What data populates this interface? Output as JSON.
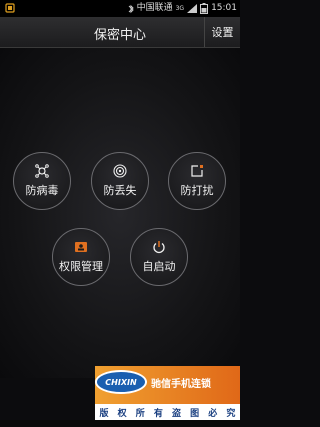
{
  "status_bar": {
    "carrier": "中国联通",
    "network": "3G",
    "time": "15:01"
  },
  "header": {
    "title": "保密中心",
    "settings_label": "设置"
  },
  "features": [
    {
      "label": "防病毒",
      "icon": "virus-icon"
    },
    {
      "label": "防丢失",
      "icon": "target-icon"
    },
    {
      "label": "防打扰",
      "icon": "block-icon"
    },
    {
      "label": "权限管理",
      "icon": "id-card-icon"
    },
    {
      "label": "自启动",
      "icon": "power-icon"
    }
  ],
  "watermark": {
    "logo": "CHIXIN",
    "brand": "驰信手机连锁",
    "copyright": [
      "版",
      "权",
      "所",
      "有",
      "盗",
      "图",
      "必",
      "究"
    ]
  }
}
